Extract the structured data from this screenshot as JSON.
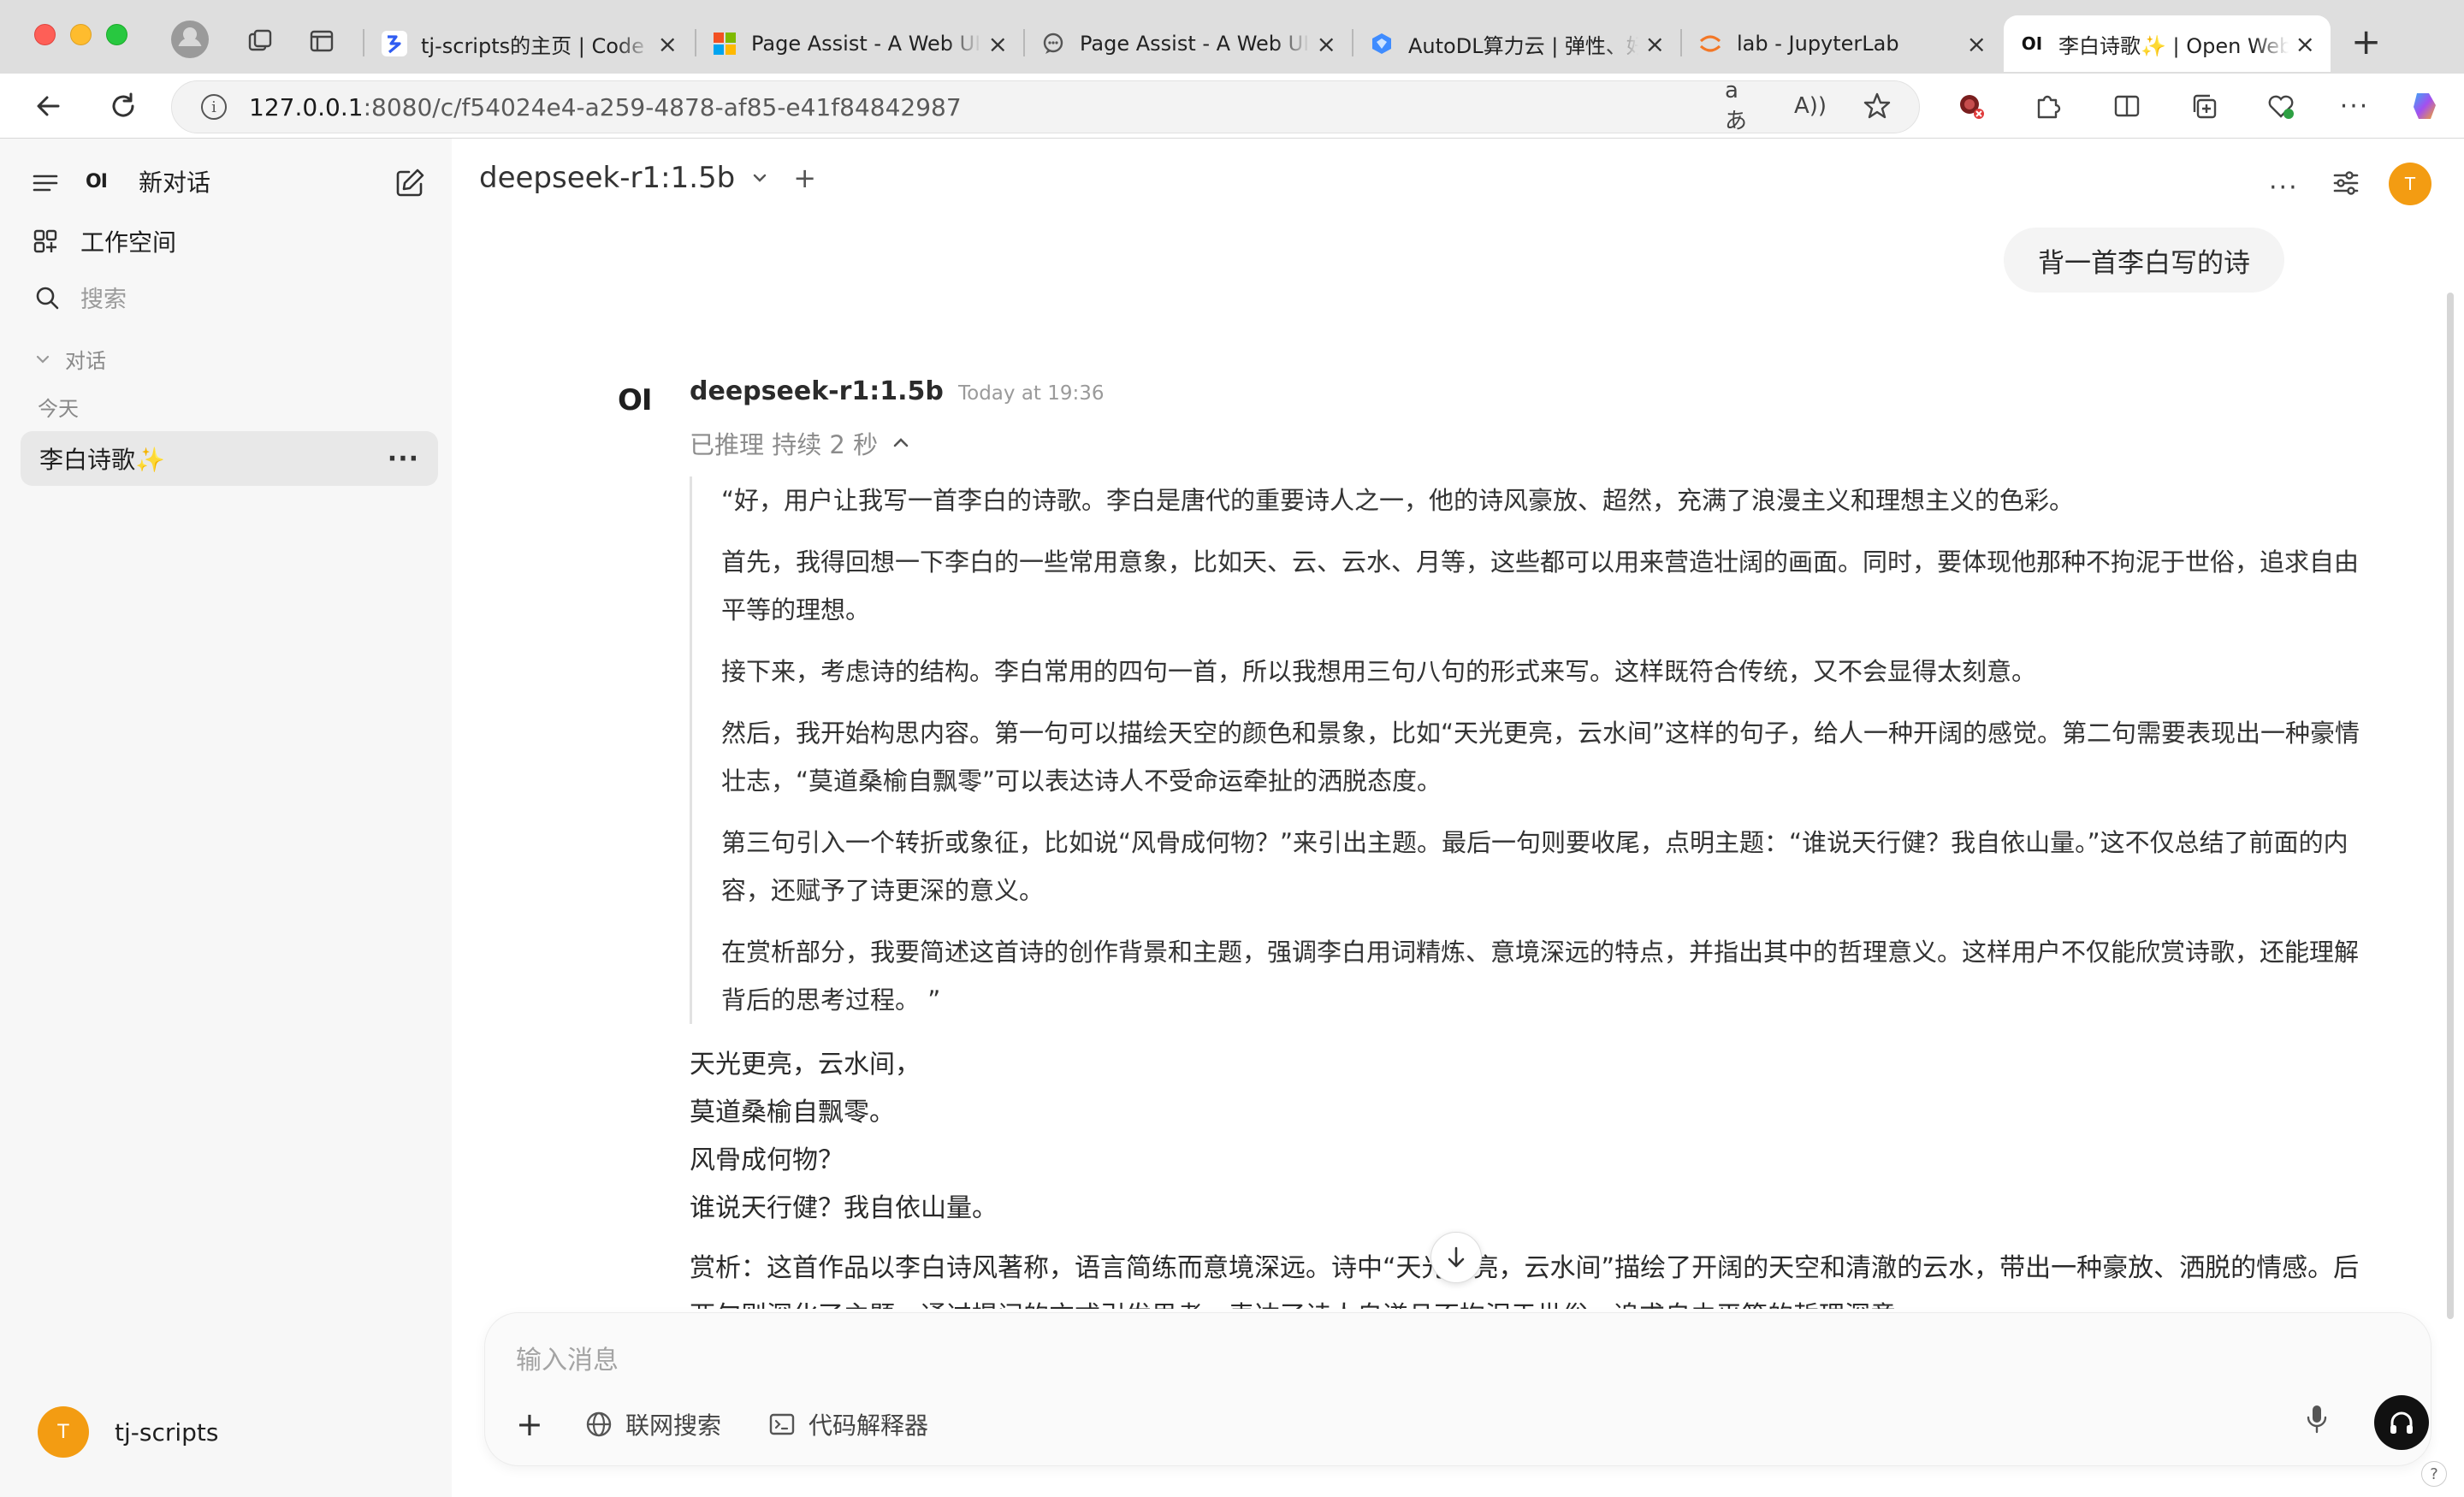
{
  "browser": {
    "tabs": [
      {
        "title": "tj-scripts的主页 | Code",
        "favicon": "codegeex-icon"
      },
      {
        "title": "Page Assist - A Web UI",
        "favicon": "microsoft-icon"
      },
      {
        "title": "Page Assist - A Web UI",
        "favicon": "chat-bubble-icon"
      },
      {
        "title": "AutoDL算力云 | 弹性、好",
        "favicon": "autodl-icon"
      },
      {
        "title": "lab - JupyterLab",
        "favicon": "jupyter-icon"
      },
      {
        "title": "李白诗歌✨ | Open Web",
        "favicon": "openwebui-icon"
      }
    ],
    "url_host": "127.0.0.1",
    "url_path": ":8080/c/f54024e4-a259-4878-af85-e41f84842987"
  },
  "sidebar": {
    "logo": "OI",
    "new_chat": "新对话",
    "workspace": "工作空间",
    "search_placeholder": "搜索",
    "section": "对话",
    "group_today": "今天",
    "chats": [
      {
        "title": "李白诗歌✨"
      }
    ],
    "user_name": "tj-scripts",
    "user_initial": "T"
  },
  "header": {
    "model": "deepseek-r1:1.5b",
    "user_initial": "T"
  },
  "conversation": {
    "user_message": "背一首李白写的诗",
    "assistant": {
      "logo": "OI",
      "model": "deepseek-r1:1.5b",
      "time": "Today at 19:36",
      "thinking_label": "已推理 持续 2 秒",
      "thinking": [
        "“好，用户让我写一首李白的诗歌。李白是唐代的重要诗人之一，他的诗风豪放、超然，充满了浪漫主义和理想主义的色彩。",
        "首先，我得回想一下李白的一些常用意象，比如天、云、云水、月等，这些都可以用来营造壮阔的画面。同时，要体现他那种不拘泥于世俗，追求自由平等的理想。",
        "接下来，考虑诗的结构。李白常用的四句一首，所以我想用三句八句的形式来写。这样既符合传统，又不会显得太刻意。",
        "然后，我开始构思内容。第一句可以描绘天空的颜色和景象，比如“天光更亮，云水间”这样的句子，给人一种开阔的感觉。第二句需要表现出一种豪情壮志，“莫道桑榆自飘零”可以表达诗人不受命运牵扯的洒脱态度。",
        "第三句引入一个转折或象征，比如说“风骨成何物？”来引出主题。最后一句则要收尾，点明主题：“谁说天行健？我自依山量。”这不仅总结了前面的内容，还赋予了诗更深的意义。",
        "在赏析部分，我要简述这首诗的创作背景和主题，强调李白用词精炼、意境深远的特点，并指出其中的哲理意义。这样用户不仅能欣赏诗歌，还能理解背后的思考过程。 ”"
      ],
      "poem": [
        "天光更亮，云水间，",
        "莫道桑榆自飘零。",
        "风骨成何物？",
        "谁说天行健？我自依山量。"
      ],
      "analysis": "赏析：这首作品以李白诗风著称，语言简练而意境深远。诗中“天光更亮，云水间”描绘了开阔的天空和清澈的云水，带出一种豪放、洒脱的情感。后两句则深化了主题，通过提问的方式引发思考，表达了诗人自谦且不拘泥于世俗，追求自由平等的哲理深意。"
    }
  },
  "composer": {
    "placeholder": "输入消息",
    "web_search": "联网搜索",
    "code_interpreter": "代码解释器"
  },
  "colors": {
    "accent": "#f39c12",
    "sidebar_bg": "#f7f7f7"
  }
}
